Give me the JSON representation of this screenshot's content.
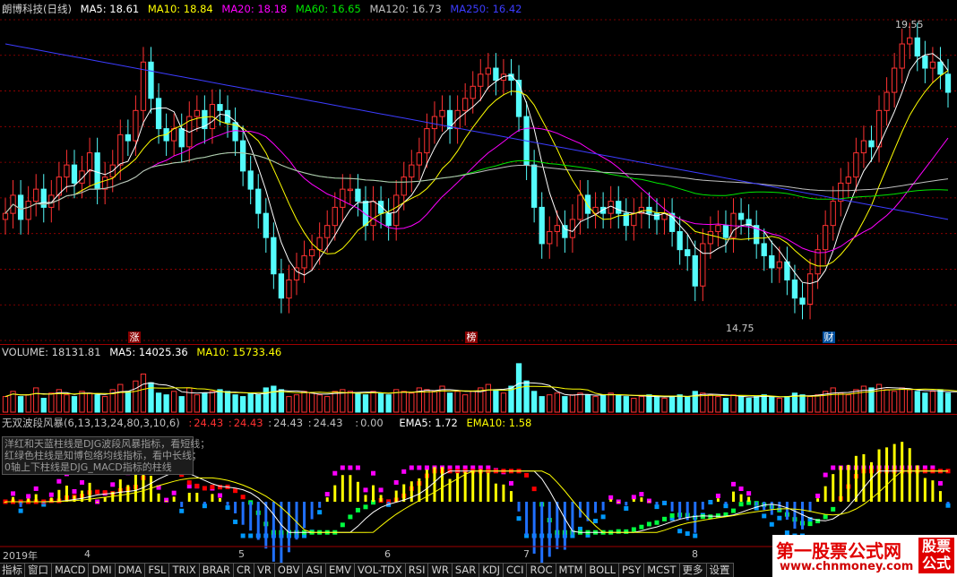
{
  "main_header": {
    "title": "朗博科技(日线)",
    "ma5": "MA5: 18.61",
    "ma10": "MA10: 18.84",
    "ma20": "MA20: 18.18",
    "ma60": "MA60: 16.65",
    "ma120": "MA120: 16.73",
    "ma250": "MA250: 16.42"
  },
  "price_labels": {
    "high": "19.55",
    "low": "14.75"
  },
  "markers": {
    "zhang": "涨",
    "bang": "榜",
    "cai": "财"
  },
  "volume_header": {
    "volume": "VOLUME: 18131.81",
    "ma5": "MA5: 14025.36",
    "ma10": "MA10: 15733.46"
  },
  "indicator_header": {
    "name": "无双波段风暴(6,13,13,24,80,3,10,6)",
    "v1": "24.43",
    "v2": "24.43",
    "v3": "24.43",
    "v4": "24.43",
    "v5": "0.00",
    "ema5": "EMA5: 1.72",
    "ema10": "EMA10: 1.58"
  },
  "indicator_note": [
    "洋红和天蓝柱线是DJG波段风暴指标，看短线；",
    "红绿色柱线是知博包络均线指标，看中长线；",
    "0轴上下柱线是DJG_MACD指标的柱线"
  ],
  "date_axis": [
    "2019年",
    "4",
    "5",
    "6",
    "7",
    "8"
  ],
  "tabs": [
    "指标",
    "窗口",
    "MACD",
    "DMI",
    "DMA",
    "FSL",
    "TRIX",
    "BRAR",
    "CR",
    "VR",
    "OBV",
    "ASI",
    "EMV",
    "VOL-TDX",
    "RSI",
    "WR",
    "SAR",
    "KDJ",
    "CCI",
    "ROC",
    "MTM",
    "BOLL",
    "PSY",
    "MCST",
    "更多",
    "设置"
  ],
  "watermark": {
    "title": "第一股票公式网",
    "url": "www.chnmoney.com",
    "box": "股票公式"
  },
  "colors": {
    "up": "#ff3232",
    "down": "#54fcfc",
    "ma5": "#ffffff",
    "ma10": "#ffff00",
    "ma20": "#ff00ff",
    "ma60": "#00e600",
    "ma120": "#c0c0c0",
    "ma250": "#3c3cff",
    "grid": "#a00000"
  },
  "chart_data": {
    "type": "candlestick",
    "ylim": [
      14.5,
      19.8
    ],
    "close": [
      16.6,
      16.9,
      16.5,
      16.8,
      17.0,
      16.7,
      16.9,
      17.2,
      17.4,
      17.1,
      17.3,
      17.6,
      17.0,
      17.2,
      17.4,
      17.9,
      17.8,
      18.3,
      19.1,
      18.5,
      18.0,
      17.8,
      18.0,
      17.7,
      18.2,
      18.3,
      18.0,
      18.4,
      18.3,
      18.1,
      17.8,
      17.3,
      17.0,
      16.6,
      16.2,
      15.6,
      15.2,
      15.5,
      15.7,
      15.9,
      16.0,
      16.2,
      16.4,
      16.7,
      17.0,
      17.0,
      16.8,
      16.4,
      16.8,
      16.6,
      16.4,
      16.9,
      17.2,
      17.4,
      17.6,
      18.0,
      18.2,
      18.3,
      18.0,
      18.3,
      18.5,
      18.7,
      18.9,
      19.0,
      18.8,
      18.9,
      18.8,
      18.2,
      17.4,
      16.7,
      16.1,
      16.3,
      16.4,
      16.2,
      16.5,
      16.9,
      16.6,
      16.7,
      16.6,
      16.8,
      16.6,
      16.4,
      16.6,
      16.7,
      16.6,
      16.5,
      16.6,
      16.3,
      16.0,
      15.9,
      15.4,
      16.1,
      16.3,
      16.4,
      16.2,
      16.6,
      16.5,
      16.4,
      16.1,
      15.9,
      15.7,
      15.8,
      15.5,
      15.2,
      15.1,
      15.6,
      16.0,
      16.4,
      16.8,
      17.1,
      17.2,
      17.6,
      17.8,
      17.7,
      18.3,
      18.6,
      19.0,
      19.4,
      19.5,
      19.2,
      19.0,
      19.1,
      18.9,
      18.6
    ],
    "volume": [
      9,
      12,
      9,
      10,
      14,
      8,
      11,
      13,
      10,
      9,
      12,
      11,
      10,
      9,
      13,
      16,
      12,
      18,
      22,
      17,
      11,
      10,
      12,
      9,
      14,
      10,
      11,
      12,
      13,
      12,
      10,
      9,
      11,
      10,
      14,
      15,
      13,
      9,
      10,
      12,
      11,
      10,
      9,
      12,
      13,
      12,
      11,
      10,
      12,
      11,
      10,
      13,
      12,
      11,
      14,
      13,
      12,
      15,
      11,
      12,
      10,
      12,
      14,
      16,
      13,
      11,
      15,
      28,
      18,
      12,
      9,
      10,
      11,
      9,
      10,
      11,
      10,
      9,
      10,
      11,
      10,
      9,
      8,
      9,
      10,
      9,
      8,
      9,
      10,
      9,
      12,
      11,
      10,
      9,
      8,
      10,
      9,
      8,
      9,
      10,
      9,
      8,
      9,
      11,
      10,
      9,
      10,
      12,
      14,
      11,
      10,
      13,
      15,
      14,
      16,
      13,
      12,
      14,
      13,
      12,
      11,
      12,
      13,
      11,
      12,
      10,
      11,
      10,
      9,
      10
    ]
  }
}
